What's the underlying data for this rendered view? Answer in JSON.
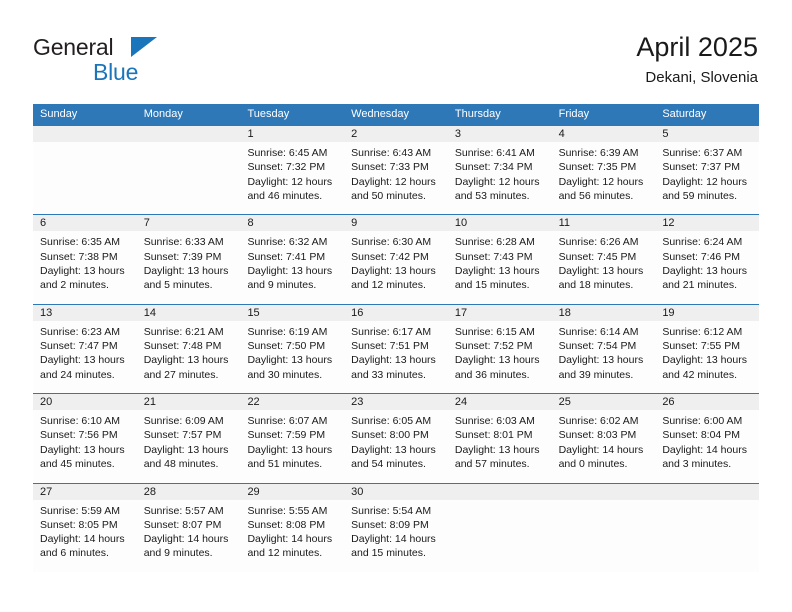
{
  "brand": {
    "name_part1": "General",
    "name_part2": "Blue",
    "triangle_icon": "triangle-icon",
    "accent_color": "#1b75bb"
  },
  "header": {
    "title": "April 2025",
    "subtitle": "Dekani, Slovenia",
    "weekday_header_color": "#2e78b7",
    "daynum_band_color": "#efefef"
  },
  "weekdays": [
    "Sunday",
    "Monday",
    "Tuesday",
    "Wednesday",
    "Thursday",
    "Friday",
    "Saturday"
  ],
  "weeks": [
    [
      {
        "day": "",
        "sunrise": "",
        "sunset": "",
        "daylight_line1": "",
        "daylight_line2": ""
      },
      {
        "day": "",
        "sunrise": "",
        "sunset": "",
        "daylight_line1": "",
        "daylight_line2": ""
      },
      {
        "day": "1",
        "sunrise": "Sunrise: 6:45 AM",
        "sunset": "Sunset: 7:32 PM",
        "daylight_line1": "Daylight: 12 hours",
        "daylight_line2": "and 46 minutes."
      },
      {
        "day": "2",
        "sunrise": "Sunrise: 6:43 AM",
        "sunset": "Sunset: 7:33 PM",
        "daylight_line1": "Daylight: 12 hours",
        "daylight_line2": "and 50 minutes."
      },
      {
        "day": "3",
        "sunrise": "Sunrise: 6:41 AM",
        "sunset": "Sunset: 7:34 PM",
        "daylight_line1": "Daylight: 12 hours",
        "daylight_line2": "and 53 minutes."
      },
      {
        "day": "4",
        "sunrise": "Sunrise: 6:39 AM",
        "sunset": "Sunset: 7:35 PM",
        "daylight_line1": "Daylight: 12 hours",
        "daylight_line2": "and 56 minutes."
      },
      {
        "day": "5",
        "sunrise": "Sunrise: 6:37 AM",
        "sunset": "Sunset: 7:37 PM",
        "daylight_line1": "Daylight: 12 hours",
        "daylight_line2": "and 59 minutes."
      }
    ],
    [
      {
        "day": "6",
        "sunrise": "Sunrise: 6:35 AM",
        "sunset": "Sunset: 7:38 PM",
        "daylight_line1": "Daylight: 13 hours",
        "daylight_line2": "and 2 minutes."
      },
      {
        "day": "7",
        "sunrise": "Sunrise: 6:33 AM",
        "sunset": "Sunset: 7:39 PM",
        "daylight_line1": "Daylight: 13 hours",
        "daylight_line2": "and 5 minutes."
      },
      {
        "day": "8",
        "sunrise": "Sunrise: 6:32 AM",
        "sunset": "Sunset: 7:41 PM",
        "daylight_line1": "Daylight: 13 hours",
        "daylight_line2": "and 9 minutes."
      },
      {
        "day": "9",
        "sunrise": "Sunrise: 6:30 AM",
        "sunset": "Sunset: 7:42 PM",
        "daylight_line1": "Daylight: 13 hours",
        "daylight_line2": "and 12 minutes."
      },
      {
        "day": "10",
        "sunrise": "Sunrise: 6:28 AM",
        "sunset": "Sunset: 7:43 PM",
        "daylight_line1": "Daylight: 13 hours",
        "daylight_line2": "and 15 minutes."
      },
      {
        "day": "11",
        "sunrise": "Sunrise: 6:26 AM",
        "sunset": "Sunset: 7:45 PM",
        "daylight_line1": "Daylight: 13 hours",
        "daylight_line2": "and 18 minutes."
      },
      {
        "day": "12",
        "sunrise": "Sunrise: 6:24 AM",
        "sunset": "Sunset: 7:46 PM",
        "daylight_line1": "Daylight: 13 hours",
        "daylight_line2": "and 21 minutes."
      }
    ],
    [
      {
        "day": "13",
        "sunrise": "Sunrise: 6:23 AM",
        "sunset": "Sunset: 7:47 PM",
        "daylight_line1": "Daylight: 13 hours",
        "daylight_line2": "and 24 minutes."
      },
      {
        "day": "14",
        "sunrise": "Sunrise: 6:21 AM",
        "sunset": "Sunset: 7:48 PM",
        "daylight_line1": "Daylight: 13 hours",
        "daylight_line2": "and 27 minutes."
      },
      {
        "day": "15",
        "sunrise": "Sunrise: 6:19 AM",
        "sunset": "Sunset: 7:50 PM",
        "daylight_line1": "Daylight: 13 hours",
        "daylight_line2": "and 30 minutes."
      },
      {
        "day": "16",
        "sunrise": "Sunrise: 6:17 AM",
        "sunset": "Sunset: 7:51 PM",
        "daylight_line1": "Daylight: 13 hours",
        "daylight_line2": "and 33 minutes."
      },
      {
        "day": "17",
        "sunrise": "Sunrise: 6:15 AM",
        "sunset": "Sunset: 7:52 PM",
        "daylight_line1": "Daylight: 13 hours",
        "daylight_line2": "and 36 minutes."
      },
      {
        "day": "18",
        "sunrise": "Sunrise: 6:14 AM",
        "sunset": "Sunset: 7:54 PM",
        "daylight_line1": "Daylight: 13 hours",
        "daylight_line2": "and 39 minutes."
      },
      {
        "day": "19",
        "sunrise": "Sunrise: 6:12 AM",
        "sunset": "Sunset: 7:55 PM",
        "daylight_line1": "Daylight: 13 hours",
        "daylight_line2": "and 42 minutes."
      }
    ],
    [
      {
        "day": "20",
        "sunrise": "Sunrise: 6:10 AM",
        "sunset": "Sunset: 7:56 PM",
        "daylight_line1": "Daylight: 13 hours",
        "daylight_line2": "and 45 minutes."
      },
      {
        "day": "21",
        "sunrise": "Sunrise: 6:09 AM",
        "sunset": "Sunset: 7:57 PM",
        "daylight_line1": "Daylight: 13 hours",
        "daylight_line2": "and 48 minutes."
      },
      {
        "day": "22",
        "sunrise": "Sunrise: 6:07 AM",
        "sunset": "Sunset: 7:59 PM",
        "daylight_line1": "Daylight: 13 hours",
        "daylight_line2": "and 51 minutes."
      },
      {
        "day": "23",
        "sunrise": "Sunrise: 6:05 AM",
        "sunset": "Sunset: 8:00 PM",
        "daylight_line1": "Daylight: 13 hours",
        "daylight_line2": "and 54 minutes."
      },
      {
        "day": "24",
        "sunrise": "Sunrise: 6:03 AM",
        "sunset": "Sunset: 8:01 PM",
        "daylight_line1": "Daylight: 13 hours",
        "daylight_line2": "and 57 minutes."
      },
      {
        "day": "25",
        "sunrise": "Sunrise: 6:02 AM",
        "sunset": "Sunset: 8:03 PM",
        "daylight_line1": "Daylight: 14 hours",
        "daylight_line2": "and 0 minutes."
      },
      {
        "day": "26",
        "sunrise": "Sunrise: 6:00 AM",
        "sunset": "Sunset: 8:04 PM",
        "daylight_line1": "Daylight: 14 hours",
        "daylight_line2": "and 3 minutes."
      }
    ],
    [
      {
        "day": "27",
        "sunrise": "Sunrise: 5:59 AM",
        "sunset": "Sunset: 8:05 PM",
        "daylight_line1": "Daylight: 14 hours",
        "daylight_line2": "and 6 minutes."
      },
      {
        "day": "28",
        "sunrise": "Sunrise: 5:57 AM",
        "sunset": "Sunset: 8:07 PM",
        "daylight_line1": "Daylight: 14 hours",
        "daylight_line2": "and 9 minutes."
      },
      {
        "day": "29",
        "sunrise": "Sunrise: 5:55 AM",
        "sunset": "Sunset: 8:08 PM",
        "daylight_line1": "Daylight: 14 hours",
        "daylight_line2": "and 12 minutes."
      },
      {
        "day": "30",
        "sunrise": "Sunrise: 5:54 AM",
        "sunset": "Sunset: 8:09 PM",
        "daylight_line1": "Daylight: 14 hours",
        "daylight_line2": "and 15 minutes."
      },
      {
        "day": "",
        "sunrise": "",
        "sunset": "",
        "daylight_line1": "",
        "daylight_line2": ""
      },
      {
        "day": "",
        "sunrise": "",
        "sunset": "",
        "daylight_line1": "",
        "daylight_line2": ""
      },
      {
        "day": "",
        "sunrise": "",
        "sunset": "",
        "daylight_line1": "",
        "daylight_line2": ""
      }
    ]
  ]
}
